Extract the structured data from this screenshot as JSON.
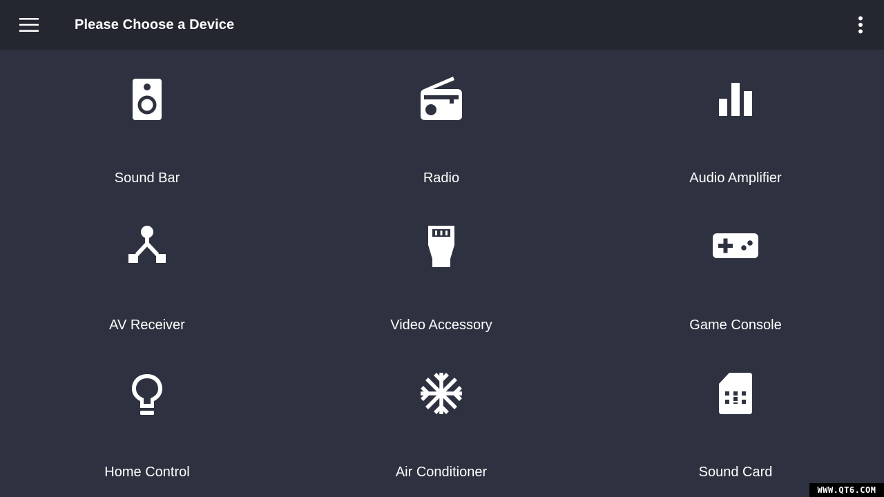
{
  "appbar": {
    "title": "Please Choose a Device",
    "menu_icon": "hamburger-menu-icon",
    "overflow_icon": "more-vert-icon"
  },
  "devices": [
    {
      "label": "Sound Bar",
      "icon": "speaker-icon"
    },
    {
      "label": "Radio",
      "icon": "radio-icon"
    },
    {
      "label": "Audio Amplifier",
      "icon": "equalizer-icon"
    },
    {
      "label": "AV Receiver",
      "icon": "av-receiver-icon"
    },
    {
      "label": "Video Accessory",
      "icon": "connector-icon"
    },
    {
      "label": "Game Console",
      "icon": "gamepad-icon"
    },
    {
      "label": "Home Control",
      "icon": "lightbulb-icon"
    },
    {
      "label": "Air Conditioner",
      "icon": "snowflake-icon"
    },
    {
      "label": "Sound Card",
      "icon": "sd-card-icon"
    }
  ],
  "watermark": "WWW.QT6.COM",
  "colors": {
    "background": "#2e3240",
    "appbar": "#242730",
    "foreground": "#ffffff"
  }
}
